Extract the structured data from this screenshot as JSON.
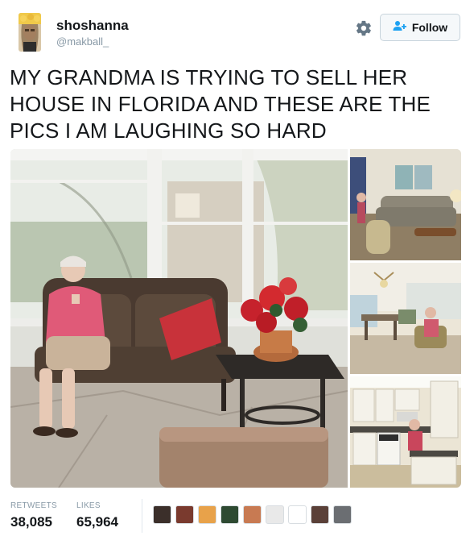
{
  "user": {
    "display_name": "shoshanna",
    "handle": "@makball_",
    "avatar_icon": "avatar-photo"
  },
  "actions": {
    "settings_icon": "gear-icon",
    "follow_label": "Follow",
    "follow_icon": "add-user-icon"
  },
  "tweet": {
    "text": "MY GRANDMA IS TRYING TO SELL HER HOUSE IN FLORIDA AND THESE ARE THE PICS I AM LAUGHING SO HARD"
  },
  "media": {
    "photos": [
      {
        "subject": "grandma-on-porch-photo"
      },
      {
        "subject": "grandma-living-room-photo"
      },
      {
        "subject": "grandma-dining-area-photo"
      },
      {
        "subject": "grandma-kitchen-photo"
      }
    ]
  },
  "stats": {
    "retweets_label": "RETWEETS",
    "retweets_value": "38,085",
    "likes_label": "LIKES",
    "likes_value": "65,964"
  },
  "likers": [
    {
      "name": "liker-avatar-1",
      "color": "#3b2f2a"
    },
    {
      "name": "liker-avatar-2",
      "color": "#7a3a2e"
    },
    {
      "name": "liker-avatar-3",
      "color": "#e8a24a"
    },
    {
      "name": "liker-avatar-4",
      "color": "#2e4a32"
    },
    {
      "name": "liker-avatar-5",
      "color": "#c87a52"
    },
    {
      "name": "liker-avatar-6",
      "color": "#e9e9e9"
    },
    {
      "name": "liker-avatar-7",
      "color": "#ffffff"
    },
    {
      "name": "liker-avatar-8",
      "color": "#5a4038"
    },
    {
      "name": "liker-avatar-9",
      "color": "#6b6e72"
    }
  ],
  "colors": {
    "text": "#14171a",
    "muted": "#8899a6",
    "follow_icon": "#1da1f2",
    "border": "#e1e8ed"
  }
}
